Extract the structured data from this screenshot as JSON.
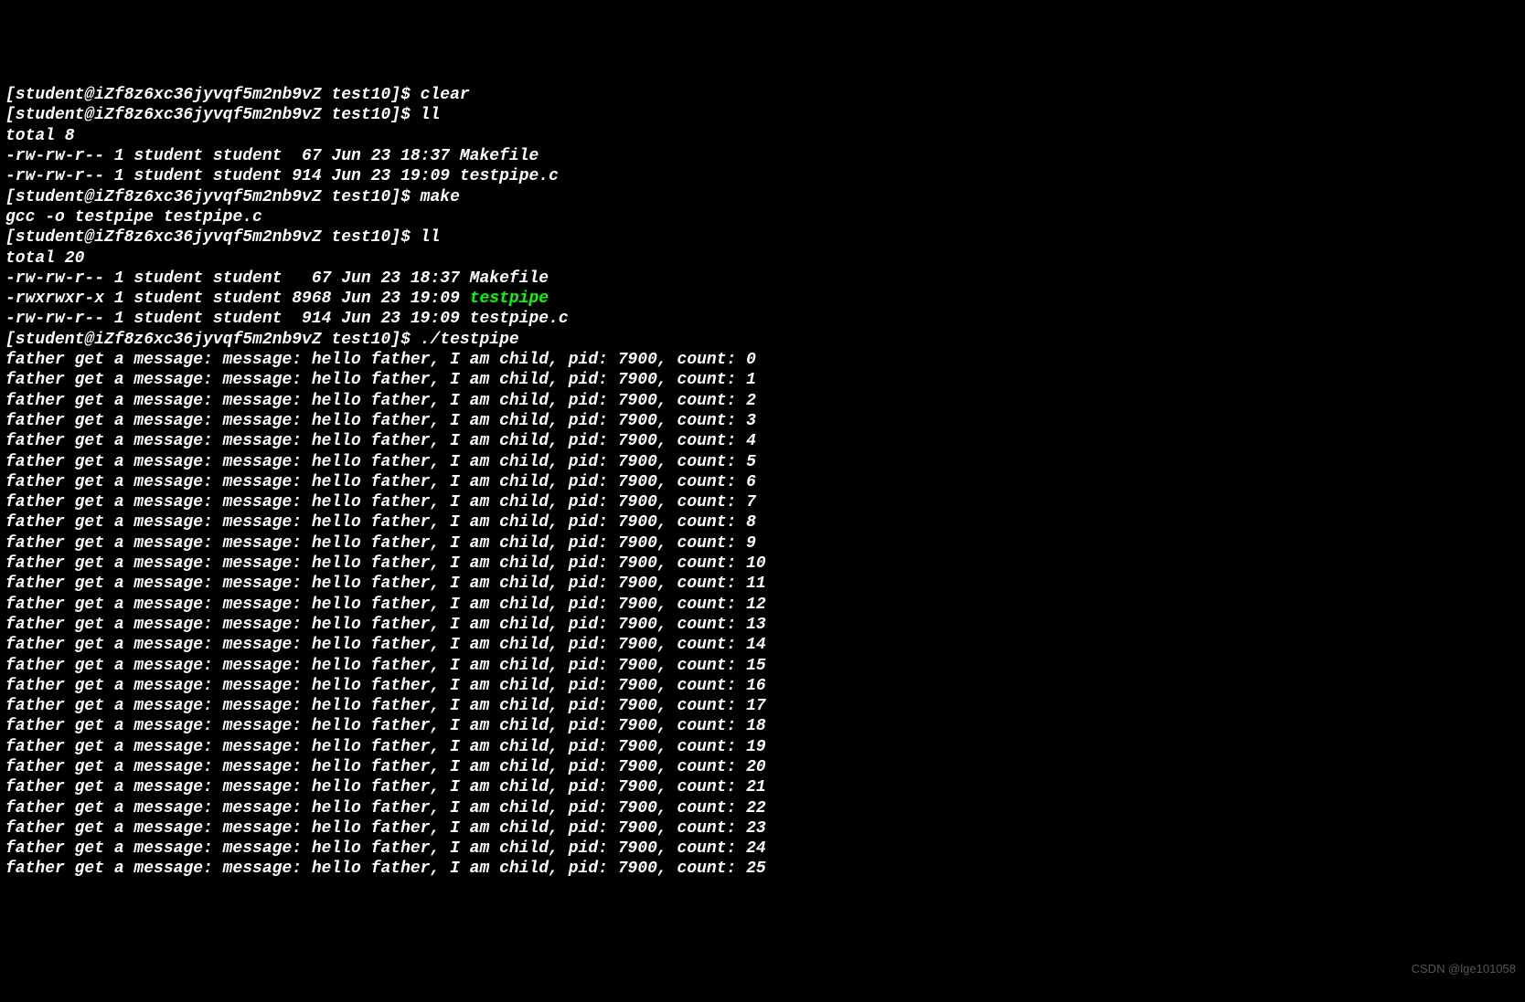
{
  "prompt_prefix": "[student@iZf8z6xc36jyvqf5m2nb9vZ test10]$ ",
  "commands": {
    "clear": "clear",
    "ll1": "ll",
    "make": "make",
    "ll2": "ll",
    "testpipe": "./testpipe"
  },
  "ll1_output": {
    "total": "total 8",
    "line1": "-rw-rw-r-- 1 student student  67 Jun 23 18:37 Makefile",
    "line2": "-rw-rw-r-- 1 student student 914 Jun 23 19:09 testpipe.c"
  },
  "make_output": "gcc -o testpipe testpipe.c",
  "ll2_output": {
    "total": "total 20",
    "line1": "-rw-rw-r-- 1 student student   67 Jun 23 18:37 Makefile",
    "line2_prefix": "-rwxrwxr-x 1 student student 8968 Jun 23 19:09 ",
    "line2_exec": "testpipe",
    "line3": "-rw-rw-r-- 1 student student  914 Jun 23 19:09 testpipe.c"
  },
  "messages": {
    "prefix": "father get a message: message: hello father, I am child, pid: 7900, count: ",
    "count_start": 0,
    "count_end": 25
  },
  "watermark": "CSDN @lge101058"
}
